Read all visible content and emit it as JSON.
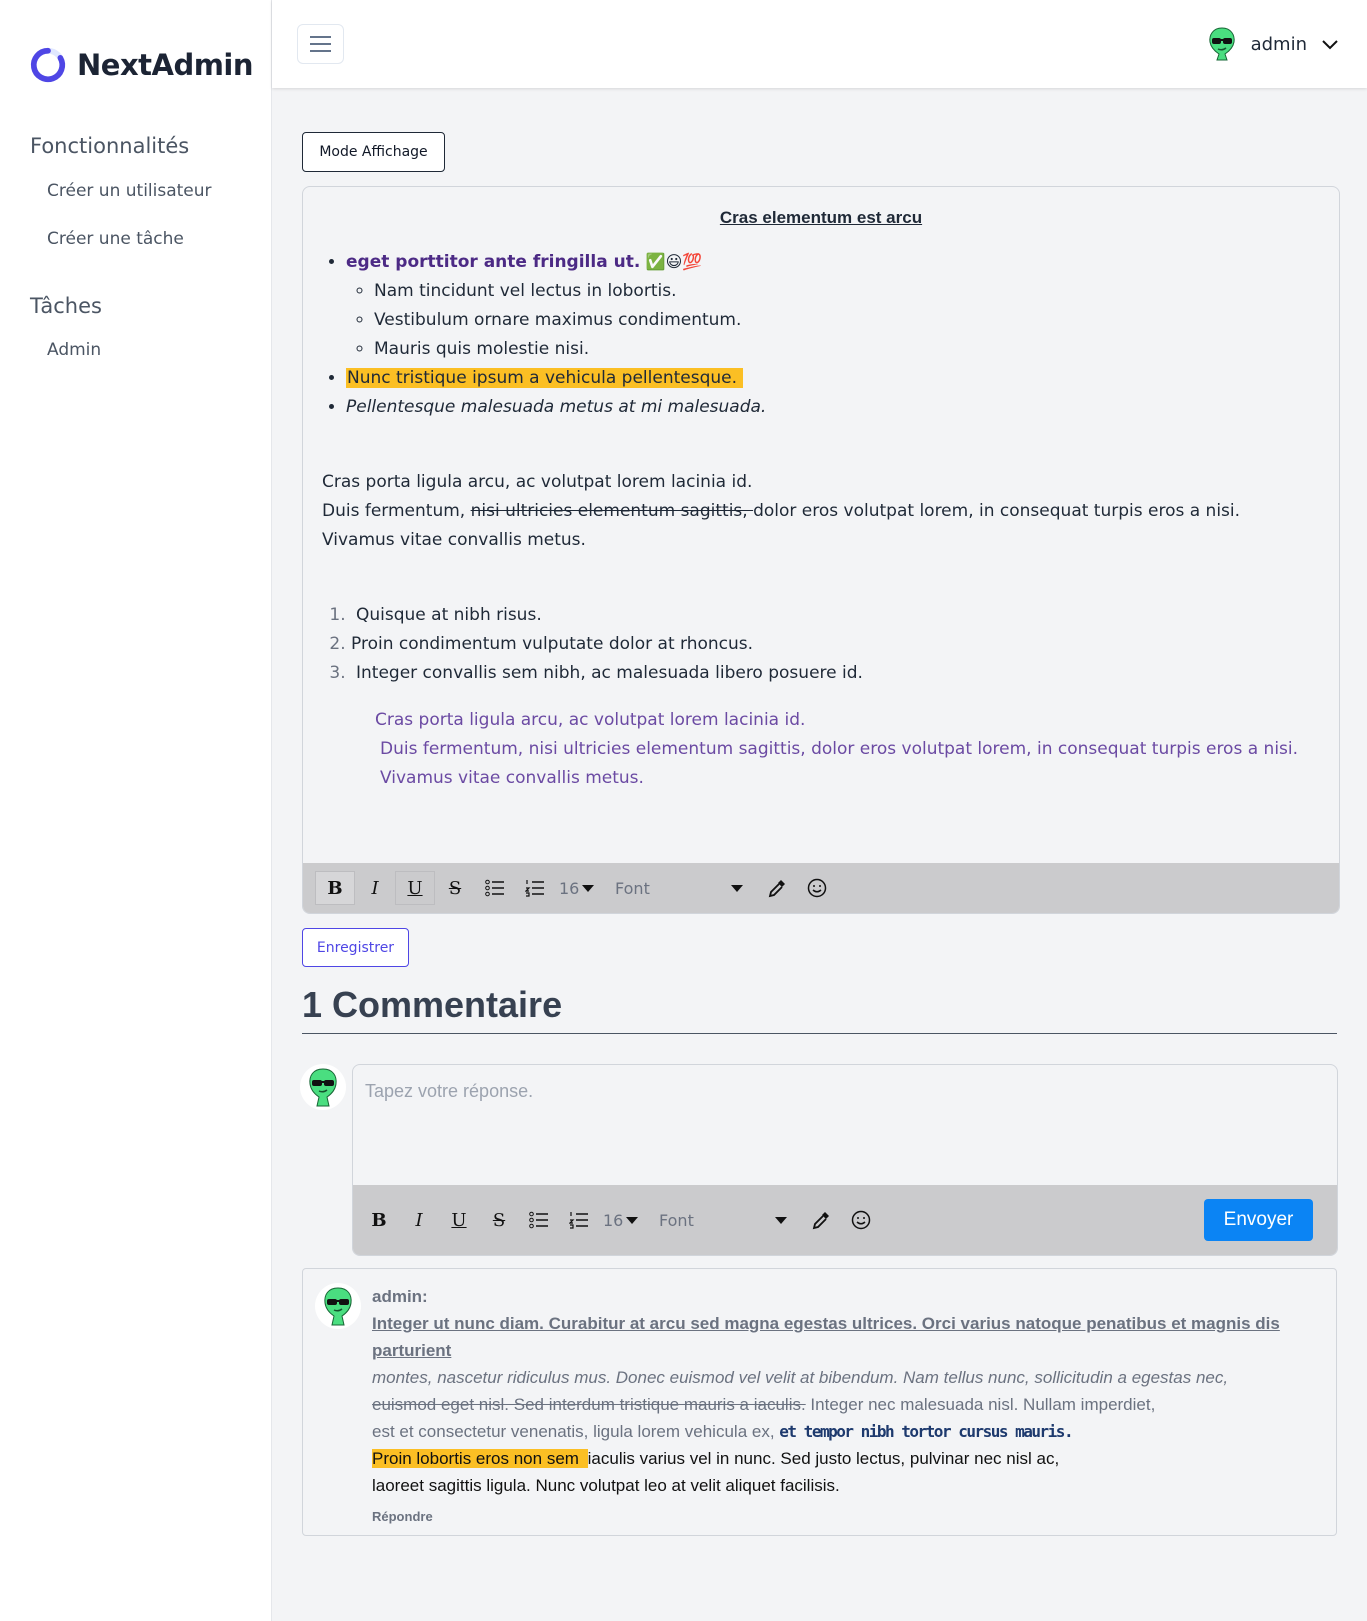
{
  "brand": {
    "name": "NextAdmin",
    "accent": "#4f46e5"
  },
  "sidebar": {
    "sections": [
      {
        "title": "Fonctionnalités",
        "items": [
          {
            "label": "Créer un utilisateur"
          },
          {
            "label": "Créer une tâche"
          }
        ]
      },
      {
        "title": "Tâches",
        "items": [
          {
            "label": "Admin"
          }
        ]
      }
    ]
  },
  "header": {
    "user_name": "admin",
    "avatar_icon": "alien-sunglasses-icon"
  },
  "main": {
    "mode_button": "Mode Affichage",
    "save_button": "Enregistrer",
    "document": {
      "title": "Cras elementum est arcu",
      "list1_item1": "eget porttitor ante fringilla ut.",
      "list1_item1_emojis": "✅😃💯",
      "list1_sub": [
        "Nam tincidunt vel lectus in lobortis.",
        "Vestibulum ornare maximus condimentum.",
        "Mauris quis molestie nisi."
      ],
      "list1_item2": "Nunc tristique ipsum a vehicula pellentesque.",
      "list1_item3": "Pellentesque malesuada metus at mi malesuada.",
      "para_line1": "Cras porta ligula arcu, ac volutpat lorem lacinia id.",
      "para_line2_a": "Duis fermentum, ",
      "para_line2_strike": "nisi ultricies elementum sagittis, ",
      "para_line2_b": "dolor eros volutpat lorem, in consequat turpis eros a nisi.",
      "para_line3": "Vivamus vitae convallis metus.",
      "ordered": [
        "Quisque at nibh risus.",
        "Proin condimentum vulputate dolor at rhoncus.",
        "Integer convallis sem nibh, ac malesuada libero posuere id."
      ],
      "quote_lines": [
        "Cras porta ligula arcu, ac volutpat lorem lacinia id.",
        "Duis fermentum, nisi ultricies elementum sagittis, dolor eros volutpat lorem, in consequat turpis eros a nisi.",
        "Vivamus vitae convallis metus."
      ]
    },
    "toolbar": {
      "bold": "B",
      "italic": "I",
      "underline": "U",
      "strike": "S",
      "font_size": "16",
      "font": "Font"
    },
    "comments": {
      "title": "1 Commentaire",
      "reply_placeholder": "Tapez votre réponse.",
      "send_button": "Envoyer",
      "items": [
        {
          "author": "admin:",
          "seg1": "Integer ut nunc diam. Curabitur at arcu sed magna egestas ultrices. Orci varius natoque penatibus et magnis dis parturient",
          "seg2": "montes, nascetur ridiculus mus. Donec euismod vel velit at bibendum. Nam tellus nunc, sollicitudin a egestas nec,",
          "seg3_strike": "euismod eget nisl. Sed interdum tristique mauris a iaculis.",
          "seg3_rest": " Integer nec malesuada nisl. Nullam imperdiet,",
          "seg4": "est et consectetur venenatis, ligula lorem vehicula ex, ",
          "seg4_bold": "et tempor nibh tortor cursus mauris",
          "seg4_end": ".",
          "seg5_hl": "Proin lobortis eros non sem ",
          "seg5_rest": "iaculis varius vel in nunc. Sed justo lectus, pulvinar nec nisl ac,",
          "seg6": "laoreet sagittis ligula. Nunc volutpat leo at velit aliquet facilisis.",
          "reply_link": "Répondre"
        }
      ]
    }
  },
  "colors": {
    "highlight": "#fbbf24",
    "primary": "#0b84f4",
    "quote": "#6b4aa3"
  }
}
